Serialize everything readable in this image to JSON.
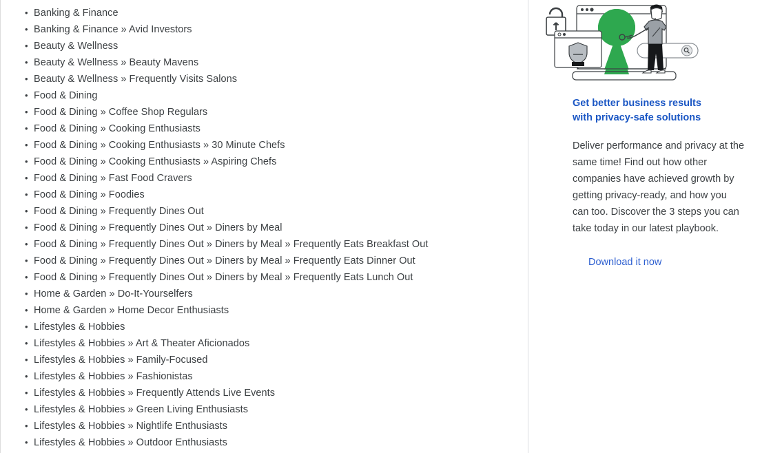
{
  "list": {
    "bullet_glyph": "•",
    "items": [
      {
        "label": "Banking & Finance"
      },
      {
        "label": "Banking & Finance » Avid Investors"
      },
      {
        "label": "Beauty & Wellness"
      },
      {
        "label": "Beauty & Wellness » Beauty Mavens"
      },
      {
        "label": "Beauty & Wellness » Frequently Visits Salons"
      },
      {
        "label": "Food & Dining"
      },
      {
        "label": "Food & Dining » Coffee Shop Regulars"
      },
      {
        "label": "Food & Dining » Cooking Enthusiasts"
      },
      {
        "label": "Food & Dining » Cooking Enthusiasts » 30 Minute Chefs"
      },
      {
        "label": "Food & Dining » Cooking Enthusiasts » Aspiring Chefs"
      },
      {
        "label": "Food & Dining » Fast Food Cravers"
      },
      {
        "label": "Food & Dining » Foodies"
      },
      {
        "label": "Food & Dining » Frequently Dines Out"
      },
      {
        "label": "Food & Dining » Frequently Dines Out » Diners by Meal"
      },
      {
        "label": "Food & Dining » Frequently Dines Out » Diners by Meal » Frequently Eats Breakfast Out"
      },
      {
        "label": "Food & Dining » Frequently Dines Out » Diners by Meal » Frequently Eats Dinner Out"
      },
      {
        "label": "Food & Dining » Frequently Dines Out » Diners by Meal » Frequently Eats Lunch Out"
      },
      {
        "label": "Home & Garden » Do-It-Yourselfers"
      },
      {
        "label": "Home & Garden » Home Decor Enthusiasts"
      },
      {
        "label": "Lifestyles & Hobbies"
      },
      {
        "label": "Lifestyles & Hobbies » Art & Theater Aficionados"
      },
      {
        "label": "Lifestyles & Hobbies » Family-Focused"
      },
      {
        "label": "Lifestyles & Hobbies » Fashionistas"
      },
      {
        "label": "Lifestyles & Hobbies » Frequently Attends Live Events"
      },
      {
        "label": "Lifestyles & Hobbies » Green Living Enthusiasts"
      },
      {
        "label": "Lifestyles & Hobbies » Nightlife Enthusiasts"
      },
      {
        "label": "Lifestyles & Hobbies » Outdoor Enthusiasts"
      }
    ]
  },
  "promo": {
    "illustration_name": "privacy-keyhole-illustration",
    "heading": "Get better business results with privacy-safe solutions",
    "body": "Deliver performance and privacy at the same time! Find out how other companies have achieved growth by getting privacy-ready, and how you can too. Discover the 3 steps you can take today in our latest playbook.",
    "cta_label": "Download it now"
  },
  "colors": {
    "link_heading": "#1a56c4",
    "link_cta": "#2d5fd0",
    "body_text": "#3c4043",
    "keyhole_green": "#2ea84f",
    "divider": "#dadce0",
    "shield_gray": "#9aa0a6",
    "outline": "#3c4043"
  }
}
